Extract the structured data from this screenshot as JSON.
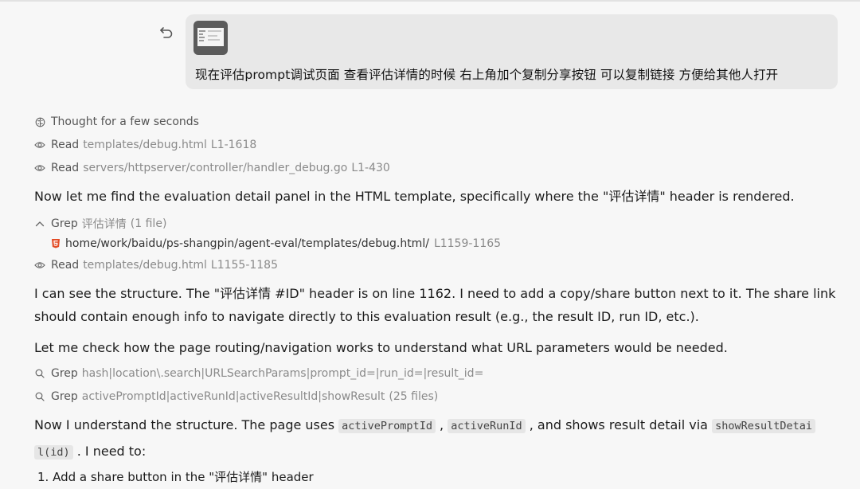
{
  "user_message": {
    "text": "现在评估prompt调试页面 查看评估详情的时候 右上角加个复制分享按钮 可以复制链接 方便给其他人打开"
  },
  "thought": {
    "label": "Thought for a few seconds"
  },
  "read1": {
    "verb": "Read",
    "path": "templates/debug.html",
    "lines": "L1-1618"
  },
  "read2": {
    "verb": "Read",
    "path": "servers/httpserver/controller/handler_debug.go",
    "lines": "L1-430"
  },
  "para1": {
    "text": "Now let me find the evaluation detail panel in the HTML template, specifically where the \"评估详情\" header is rendered."
  },
  "grep1": {
    "verb": "Grep",
    "pattern": "评估详情",
    "count": "(1 file)",
    "result": {
      "path": "home/work/baidu/ps-shangpin/agent-eval/templates/debug.html/",
      "lines": "L1159-1165"
    }
  },
  "read3": {
    "verb": "Read",
    "path": "templates/debug.html",
    "lines": "L1155-1185"
  },
  "para2": {
    "line1": "I can see the structure. The \"评估详情 #ID\" header is on line 1162. I need to add a copy/share button next to it. The share link",
    "line2": "should contain enough info to navigate directly to this evaluation result (e.g., the result ID, run ID, etc.)."
  },
  "para3": {
    "text": "Let me check how the page routing/navigation works to understand what URL parameters would be needed."
  },
  "grep2": {
    "verb": "Grep",
    "pattern": "hash|location\\.search|URLSearchParams|prompt_id=|run_id=|result_id="
  },
  "grep3": {
    "verb": "Grep",
    "pattern": "activePromptId|activeRunId|activeResultId|showResult",
    "count": "(25 files)"
  },
  "para4": {
    "intro": "Now I understand the structure. The page uses ",
    "code1": "activePromptId",
    "sep": " , ",
    "code2": "activeRunId",
    "mid": " , and shows result detail via ",
    "code3a": "showResultDetai",
    "code3b": "l(id)",
    "end": " . I need to:"
  },
  "list": {
    "item1": "1. Add a share button in the \"评估详情\" header"
  },
  "icons": {
    "undo": "undo-icon",
    "brain": "brain-icon",
    "eye": "eye-icon",
    "chevron": "chevron-up-icon",
    "search": "search-icon",
    "html5": "html5-file-icon"
  },
  "colors": {
    "bubble": "#e8e8e8",
    "html5": "#e34c26",
    "muted": "#8a8a8a"
  }
}
